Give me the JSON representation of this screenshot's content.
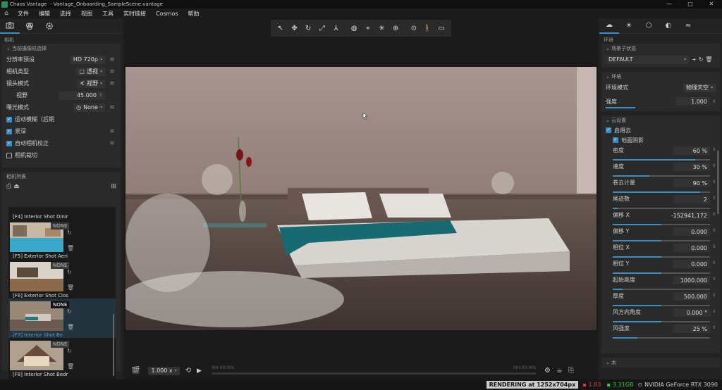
{
  "window": {
    "title": "Chaos Vantage  - Vantage_Onboarding_SampleScene.vantage",
    "controls": [
      "—",
      "□",
      "✕"
    ]
  },
  "menu": [
    "文件",
    "编辑",
    "选择",
    "视图",
    "工具",
    "实时链接",
    "Cosmos",
    "帮助"
  ],
  "left": {
    "section_title": "相机",
    "panel_title": "当前摄像机选择",
    "rows": [
      {
        "label": "分辨率预设",
        "value": "HD 720p"
      },
      {
        "label": "相机类型",
        "value": "透视"
      },
      {
        "label": "镜头模式",
        "value": "视野"
      },
      {
        "label": "视野",
        "value": "45.000"
      },
      {
        "label": "曝光模式",
        "value": "None"
      }
    ],
    "checks": [
      {
        "label": "运动模糊（后期",
        "checked": true
      },
      {
        "label": "景深",
        "checked": true
      },
      {
        "label": "自动相机校正",
        "checked": true
      },
      {
        "label": "相机裁切",
        "checked": false
      }
    ],
    "list_title": "相机列表",
    "cams": [
      "[F4] Interior Shot Dinir",
      "[F5] Exterior Shot Aeri",
      "[F6] Exterior Shot Clos",
      "[F7] Interior Shot Be",
      "[F8] Interior Shot Bedr"
    ],
    "none_label": "NONE"
  },
  "bottom": {
    "speed": "1.000 x",
    "time_start": "0m:00.00s",
    "time_end": "0m:00.00s"
  },
  "right": {
    "section_title": "环境",
    "state_title": "场景子状态",
    "state_value": "DEFAULT",
    "env_title": "环境",
    "env_mode_label": "环境模式",
    "env_mode_value": "物理天空",
    "intensity_label": "强度",
    "intensity_value": "1.000",
    "cloud_title": "云设置",
    "enable_cloud": "启用云",
    "ground_shadow": "地面阴影",
    "params": [
      {
        "label": "密度",
        "value": "60 %",
        "fill": 0.85
      },
      {
        "label": "速度",
        "value": "30 %",
        "fill": 0.38
      },
      {
        "label": "卷云计量",
        "value": "90 %",
        "fill": 0.9
      },
      {
        "label": "尾迹数",
        "value": "2",
        "fill": 0.05
      },
      {
        "label": "偏移 X",
        "value": "-152941.172",
        "fill": 0.5
      },
      {
        "label": "偏移 Y",
        "value": "0.000",
        "fill": 0.5
      },
      {
        "label": "相位 X",
        "value": "0.000",
        "fill": 0.5
      },
      {
        "label": "相位 Y",
        "value": "0.000",
        "fill": 0.5
      },
      {
        "label": "起始高度",
        "value": "1000.000",
        "fill": 0.1
      },
      {
        "label": "厚度",
        "value": "500.000",
        "fill": 0.5
      },
      {
        "label": "风方向角度",
        "value": "0.000 °",
        "fill": 0.5
      },
      {
        "label": "风强度",
        "value": "25 %",
        "fill": 0.25
      }
    ],
    "sun_title": "太"
  },
  "status": {
    "render": "RENDERING at 1252x704px",
    "red": "1.83",
    "vram": "3.31GB",
    "gpu": "NVIDIA GeForce RTX 3090"
  }
}
